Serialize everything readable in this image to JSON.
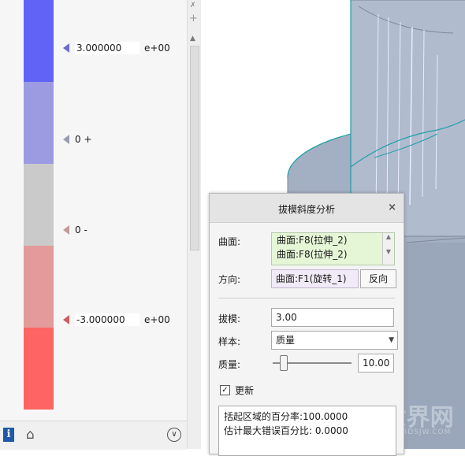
{
  "legend": {
    "bands": [
      {
        "color": "#6163f7"
      },
      {
        "color": "#9c9be2"
      },
      {
        "color": "#cacaca"
      },
      {
        "color": "#e49a9a"
      },
      {
        "color": "#ff6464"
      }
    ],
    "ticks": [
      {
        "value": "3.000000",
        "exp": "e+00",
        "arrow_color": "#6b6bd6"
      },
      {
        "label": "0 +",
        "arrow_color": "#9a9ab2"
      },
      {
        "label": "0 -",
        "arrow_color": "#c29a9a"
      },
      {
        "value": "-3.000000",
        "exp": "e+00",
        "arrow_color": "#d05c5c"
      }
    ]
  },
  "footer": {
    "info_icon": "info-icon",
    "info_glyph": "i",
    "home_icon": "home-icon",
    "expand_icon": "chevron-down-circle-icon"
  },
  "dialog": {
    "title": "拔模斜度分析",
    "close_icon": "close-icon",
    "surface_label": "曲面:",
    "surfaces": [
      "曲面:F8(拉伸_2)",
      "曲面:F8(拉伸_2)"
    ],
    "direction_label": "方向:",
    "direction_value": "曲面:F1(旋转_1)",
    "reverse_button": "反向",
    "draft_label": "拔模:",
    "draft_value": "3.00",
    "sample_label": "样本:",
    "sample_value": "质量",
    "quality_label": "质量:",
    "quality_value": "10.00",
    "quality_slider_fraction": 0.1,
    "update_label": "更新",
    "update_checked": true,
    "results": [
      "括起区域的百分率:100.0000",
      "估计最大错误百分比: 0.0000"
    ]
  },
  "watermark": {
    "text": "3D世界网",
    "sub": "WWW.3DSJW.COM"
  },
  "colors": {
    "model_fill": "#a8b4c6",
    "model_edge": "#1e9ea8",
    "model_line": "#e8ecff"
  }
}
